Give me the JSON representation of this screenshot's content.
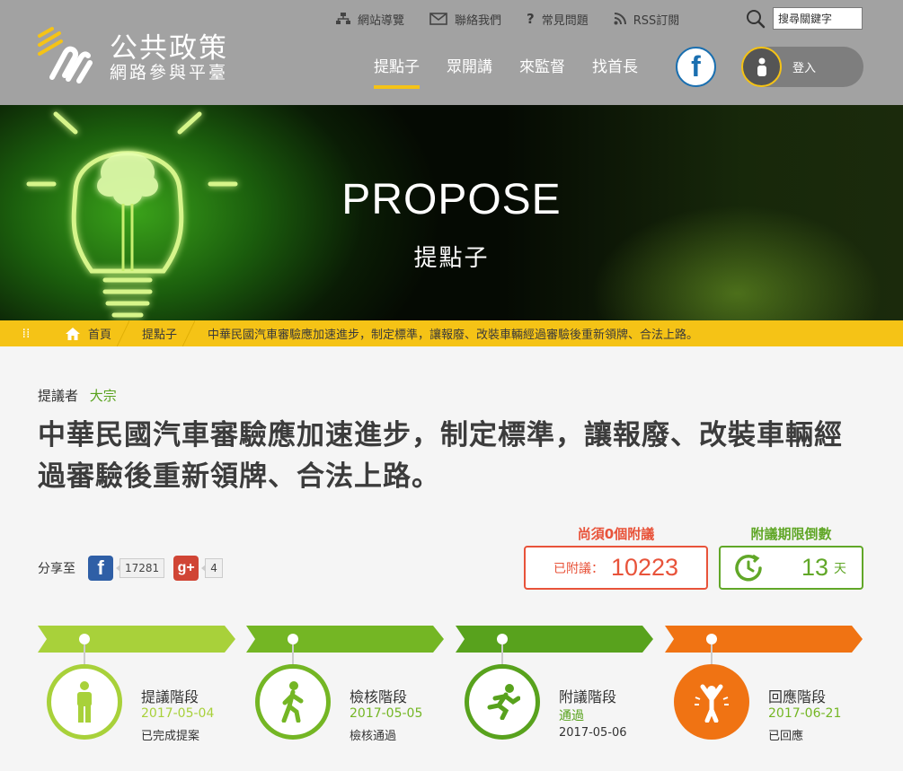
{
  "site": {
    "title_line1": "公共政策",
    "title_line2": "網路參與平臺"
  },
  "toplinks": [
    {
      "label": "網站導覽",
      "icon": "sitemap-icon"
    },
    {
      "label": "聯絡我們",
      "icon": "mail-icon"
    },
    {
      "label": "常見問題",
      "icon": "question-icon"
    },
    {
      "label": "RSS訂閱",
      "icon": "rss-icon"
    }
  ],
  "search": {
    "placeholder": "搜尋關鍵字"
  },
  "nav": [
    {
      "label": "提點子",
      "active": true
    },
    {
      "label": "眾開講",
      "active": false
    },
    {
      "label": "來監督",
      "active": false
    },
    {
      "label": "找首長",
      "active": false
    }
  ],
  "facebook_glyph": "f",
  "login_label": "登入",
  "hero": {
    "title": "PROPOSE",
    "subtitle": "提點子"
  },
  "breadcrumb": [
    {
      "label": "首頁"
    },
    {
      "label": "提點子"
    },
    {
      "label": "中華民國汽車審驗應加速進步，制定標準，讓報廢、改裝車輛經過審驗後重新領牌、合法上路。"
    }
  ],
  "proposal": {
    "proposer_label": "提議者",
    "proposer_name": "大宗",
    "title": "中華民國汽車審驗應加速進步，制定標準，讓報廢、改裝車輛經過審驗後重新領牌、合法上路。"
  },
  "share": {
    "label": "分享至",
    "facebook_glyph": "f",
    "facebook_count": "17281",
    "googleplus_glyph": "g+",
    "googleplus_count": "4"
  },
  "endorse": {
    "need_label": "尚須0個附議",
    "signed_label": "已附議：",
    "signed_count": "10223",
    "countdown_label": "附議期限倒數",
    "days_left": "13",
    "days_unit": "天"
  },
  "colors": {
    "accent_yellow": "#f5c316",
    "green_light": "#a8d13a",
    "green_mid": "#74b624",
    "green_dark": "#58a21d",
    "orange": "#f07313",
    "red": "#e8533a"
  },
  "stages": [
    {
      "name": "提議階段",
      "date": "2017-05-04",
      "status": "已完成提案",
      "icon": "standing-person-icon",
      "color": "#a8d13a"
    },
    {
      "name": "檢核階段",
      "date": "2017-05-05",
      "status": "檢核通過",
      "icon": "walking-person-icon",
      "color": "#74b624"
    },
    {
      "name": "附議階段",
      "date": "通過",
      "status": "2017-05-06",
      "icon": "running-person-icon",
      "color": "#58a21d"
    },
    {
      "name": "回應階段",
      "date": "2017-06-21",
      "status": "已回應",
      "icon": "cheering-person-icon",
      "color": "#f07313"
    }
  ]
}
